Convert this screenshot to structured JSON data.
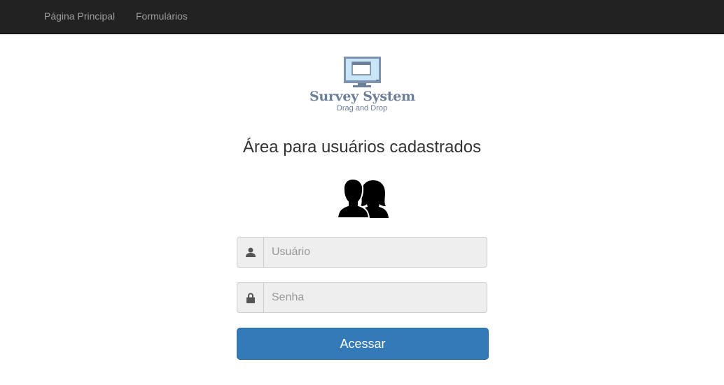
{
  "navbar": {
    "links": [
      {
        "label": "Página Principal"
      },
      {
        "label": "Formulários"
      }
    ]
  },
  "logo": {
    "title": "Survey System",
    "subtitle": "Drag and Drop"
  },
  "page": {
    "heading": "Área para usuários cadastrados"
  },
  "login_form": {
    "username": {
      "placeholder": "Usuário",
      "value": "",
      "icon": "user-icon"
    },
    "password": {
      "placeholder": "Senha",
      "value": "",
      "icon": "lock-icon"
    },
    "submit_label": "Acessar"
  },
  "colors": {
    "navbar_bg": "#222222",
    "nav_link": "#9d9d9d",
    "primary_button": "#337ab7",
    "logo_text": "#6b7f99"
  }
}
